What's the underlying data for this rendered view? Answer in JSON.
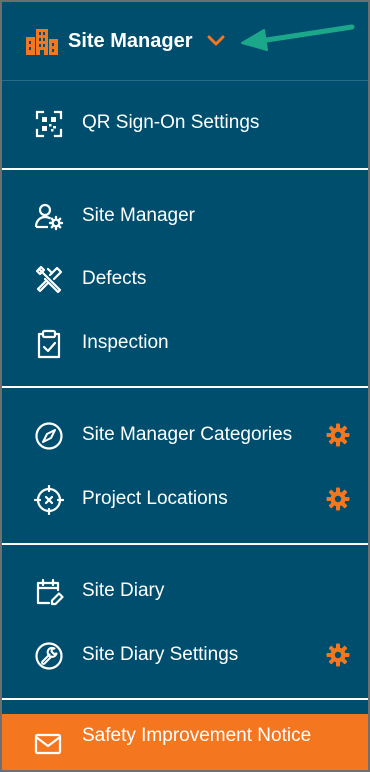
{
  "colors": {
    "panel_background": "#004E6E",
    "accent_orange": "#F47720",
    "arrow_teal": "#1BA88A",
    "text": "#FFFFFF"
  },
  "header": {
    "title": "Site Manager",
    "icon": "buildings-icon",
    "expand_icon": "chevron-down-icon",
    "annotation": "arrow-pointer-icon"
  },
  "menu": {
    "qr_sign_on": {
      "label": "QR Sign-On Settings",
      "icon": "qr-code-icon"
    },
    "site_manager": {
      "label": "Site Manager",
      "icon": "user-gear-icon"
    },
    "defects": {
      "label": "Defects",
      "icon": "tools-icon"
    },
    "inspection": {
      "label": "Inspection",
      "icon": "clipboard-check-icon"
    },
    "site_manager_categories": {
      "label": "Site Manager Categories",
      "icon": "compass-icon",
      "settings_icon": "gear-icon"
    },
    "project_locations": {
      "label": "Project Locations",
      "icon": "crosshair-icon",
      "settings_icon": "gear-icon"
    },
    "site_diary": {
      "label": "Site Diary",
      "icon": "calendar-edit-icon"
    },
    "site_diary_settings": {
      "label": "Site Diary Settings",
      "icon": "wrench-circle-icon",
      "settings_icon": "gear-icon"
    },
    "safety_notice": {
      "label": "Safety Improvement Notice",
      "icon": "envelope-icon",
      "active": true
    }
  }
}
